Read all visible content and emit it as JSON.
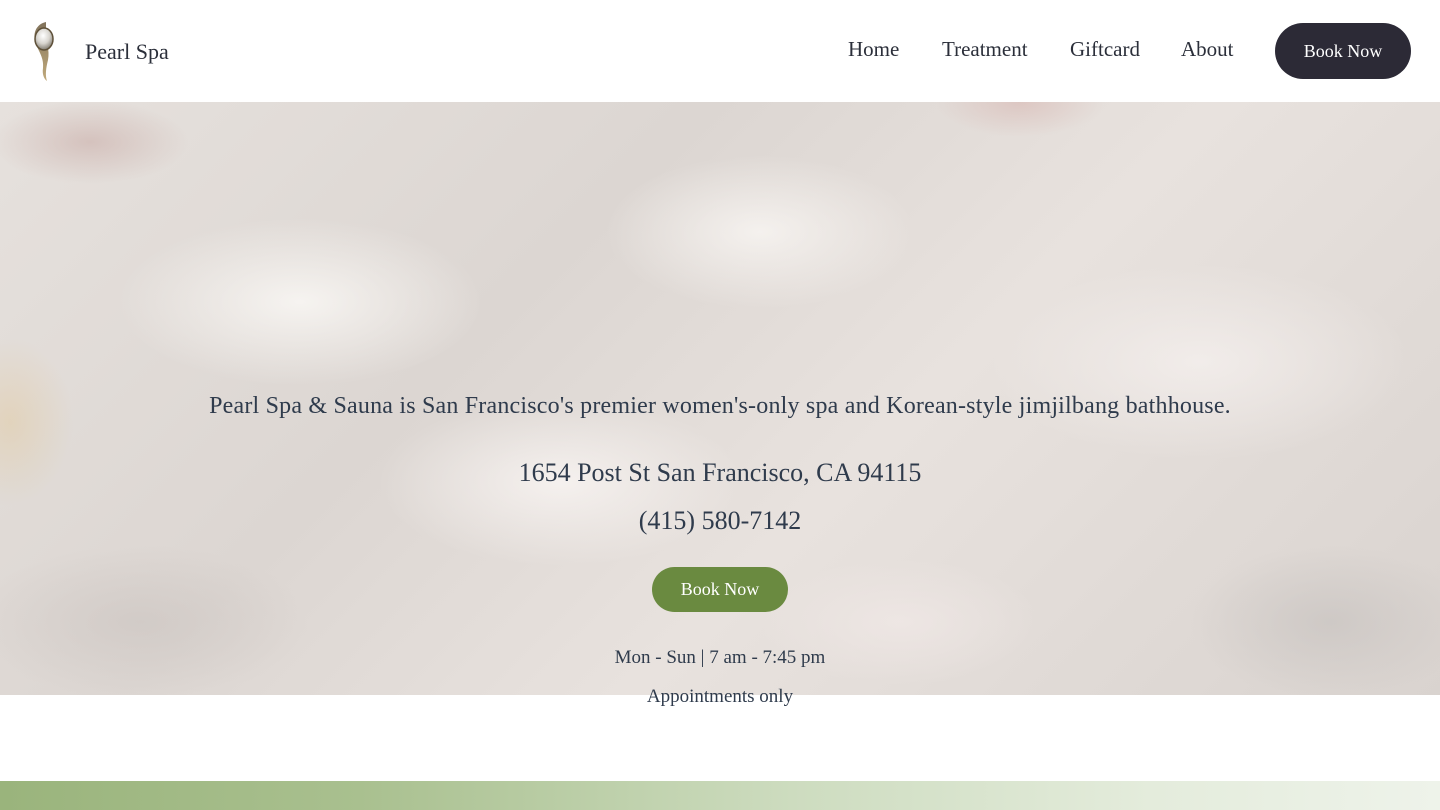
{
  "brand": {
    "name": "Pearl Spa",
    "logo_icon": "pearl-drop-icon"
  },
  "nav": {
    "items": [
      {
        "label": "Home"
      },
      {
        "label": "Treatment"
      },
      {
        "label": "Giftcard"
      },
      {
        "label": "About"
      }
    ],
    "cta_label": "Book Now"
  },
  "hero": {
    "tagline": "Pearl Spa & Sauna is San Francisco's premier women's-only spa and Korean-style jimjilbang bathhouse.",
    "address": "1654 Post St San Francisco, CA 94115",
    "phone": "(415) 580-7142",
    "cta_label": "Book Now",
    "hours": "Mon - Sun | 7 am - 7:45 pm",
    "appointments": "Appointments only"
  },
  "colors": {
    "header_button": "#2c2a36",
    "hero_button": "#6a8a40",
    "text": "#2f3b4c",
    "band_start": "#9ab47c",
    "band_end": "#eef3ea"
  }
}
